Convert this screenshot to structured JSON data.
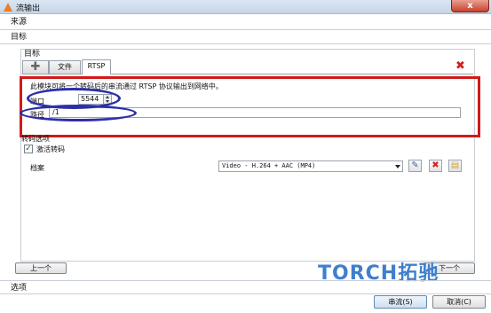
{
  "window": {
    "title": "流输出",
    "close_label": "x"
  },
  "sections": {
    "source": "来源",
    "target": "目标",
    "options": "选项"
  },
  "target_group": {
    "title": "目标",
    "tabs": [
      {
        "label": "✚",
        "icon": "add-icon"
      },
      {
        "label": "文件"
      },
      {
        "label": "RTSP"
      }
    ],
    "remove_icon": "✖"
  },
  "rtsp": {
    "description": "此模块可将一个转码后的串流通过 RTSP 协议输出到网络中。",
    "port_label": "端口",
    "port_value": "5544",
    "path_label": "路径",
    "path_value": "/1"
  },
  "transcode": {
    "title": "转码选项",
    "enable_label": "激活转码",
    "enable_checked": true,
    "check_mark": "✓",
    "profile_label": "档案",
    "profile_value": "Video - H.264 + AAC (MP4)",
    "edit_icon": "✎",
    "delete_icon": "✖",
    "new_icon": "▤"
  },
  "nav": {
    "prev_label": "上一个",
    "next_label": "下一个"
  },
  "watermark": "TORCH拓驰",
  "footer": {
    "stream_label": "串流(S)",
    "cancel_label": "取消(C)"
  },
  "colors": {
    "annotation_red": "#d01a1a",
    "annotation_blue": "#2d2fa8",
    "watermark_blue": "#3f7fd0"
  }
}
